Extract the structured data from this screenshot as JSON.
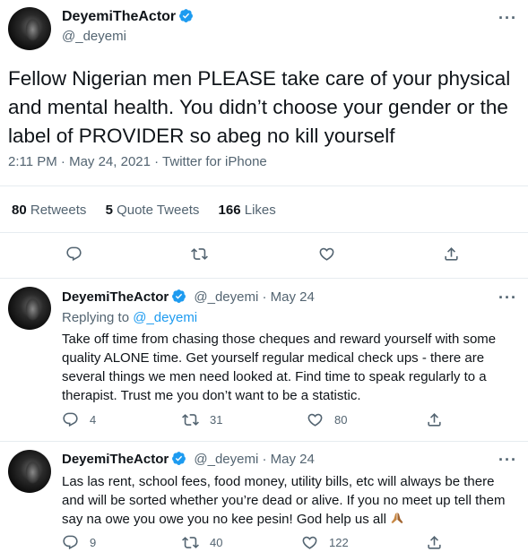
{
  "main_tweet": {
    "name": "DeyemiTheActor",
    "handle": "@_deyemi",
    "text": "Fellow Nigerian men PLEASE take care of your physical and mental health. You didn’t choose your gender or the label of PROVIDER so abeg no kill yourself",
    "meta": "2:11 PM · May 24, 2021 · Twitter for iPhone",
    "stats": {
      "retweets_count": "80",
      "retweets_label": "Retweets",
      "quotes_count": "5",
      "quotes_label": "Quote Tweets",
      "likes_count": "166",
      "likes_label": "Likes"
    },
    "more": "···"
  },
  "replies": [
    {
      "name": "DeyemiTheActor",
      "handle_date": "@_deyemi · May 24",
      "replying_prefix": "Replying to",
      "replying_to": "@_deyemi",
      "text": "Take off time from chasing those cheques and reward yourself with some quality ALONE time. Get yourself regular medical check ups - there are several things we men need looked at. Find time to speak regularly to a therapist. Trust me you don’t want to be a statistic.",
      "replies": "4",
      "retweets": "31",
      "likes": "80",
      "more": "···"
    },
    {
      "name": "DeyemiTheActor",
      "handle_date": "@_deyemi · May 24",
      "text": "Las las rent, school fees, food money, utility bills, etc will always be there and will be sorted whether you’re dead or alive. If you no meet up tell them say na owe you owe you no kee pesin! God help us all",
      "replies": "9",
      "retweets": "40",
      "likes": "122",
      "more": "···"
    }
  ],
  "icons": {
    "verified": "verified-badge-icon",
    "reply": "reply-icon",
    "retweet": "retweet-icon",
    "like": "heart-icon",
    "share": "share-icon",
    "emoji": "folded-hands-emoji"
  },
  "colors": {
    "accent": "#1d9bf0",
    "secondary_text": "#536471",
    "divider": "#e6ecf0"
  }
}
